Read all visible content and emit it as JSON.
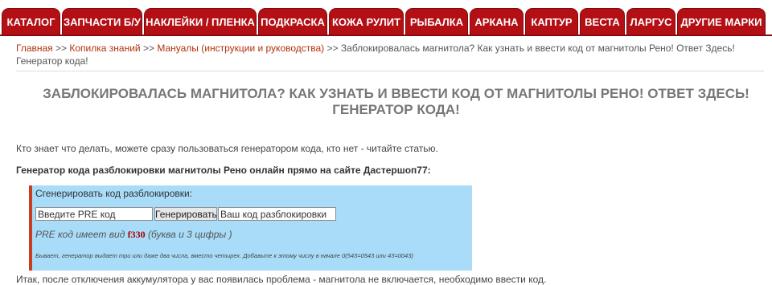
{
  "nav": {
    "items": [
      {
        "label": "КАТАЛОГ"
      },
      {
        "label": "ЗАПЧАСТИ Б/У"
      },
      {
        "label": "НАКЛЕЙКИ / ПЛЕНКА"
      },
      {
        "label": "ПОДКРАСКА"
      },
      {
        "label": "КОЖА РУЛИТ"
      },
      {
        "label": "РЫБАЛКА"
      },
      {
        "label": "АРКАНА"
      },
      {
        "label": "КАПТУР"
      },
      {
        "label": "ВЕСТА"
      },
      {
        "label": "ЛАРГУС"
      },
      {
        "label": "ДРУГИЕ МАРКИ"
      }
    ]
  },
  "breadcrumb": {
    "home": "Главная",
    "knowledge": "Копилка знаний",
    "manuals": "Мануалы (инструкции и руководства)",
    "separator": ">>",
    "current": "Заблокировалась магнитола? Как узнать и ввести код от магнитолы Рено! Ответ Здесь! Генератор кода!"
  },
  "article": {
    "title": "ЗАБЛОКИРОВАЛАСЬ МАГНИТОЛА? КАК УЗНАТЬ И ВВЕСТИ КОД ОТ МАГНИТОЛЫ РЕНО! ОТВЕТ ЗДЕСЬ! ГЕНЕРАТОР КОДА!",
    "intro": "Кто знает что делать, можете сразу пользоваться генератором кода, кто нет - читайте статью.",
    "subhead": "Генератор кода разблокировки магнитолы Рено онлайн прямо на сайте Дастершоп77:",
    "outro": "Итак, после отключения аккумулятора у вас появилась проблема - магнитола не включается, необходимо ввести код."
  },
  "generator": {
    "label": "Сгенерировать код разблокировки:",
    "pre_placeholder": "Введите PRE код",
    "button_label": "Генерировать",
    "output_placeholder": "Ваш код разблокировки",
    "hint_prefix": "PRE код имеет вид",
    "hint_code": "f330",
    "hint_suffix": "(буква и 3 цифры )",
    "note": "Бывает, генератор выдает три или даже два числа, вместо четырех. Добавьте к этому числу в начале 0(543=0543 или 43=0043)"
  },
  "colors": {
    "nav_tab": "#b30f14",
    "link": "#b0320b",
    "widget_bg": "#a8dcf9",
    "widget_accent": "#cc3b1f",
    "hint_code": "#b00000"
  }
}
